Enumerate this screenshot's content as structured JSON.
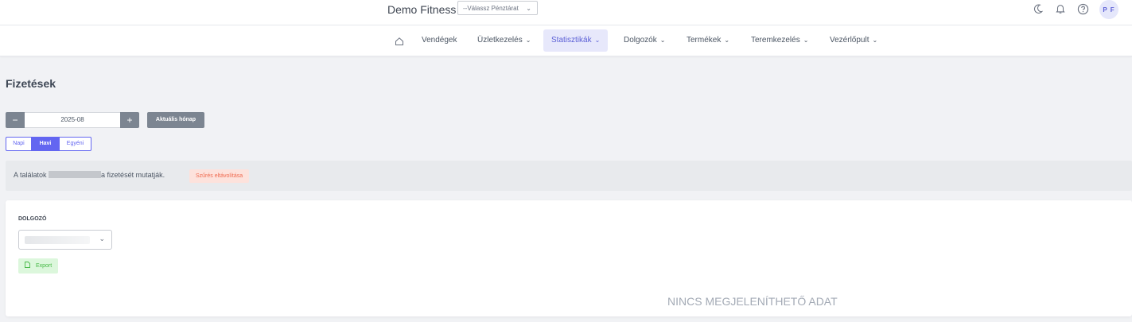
{
  "header": {
    "brand": "Demo Fitness",
    "register_select": {
      "value": "--Válassz Pénztárat"
    },
    "avatar_initials": "P F"
  },
  "nav": {
    "items": [
      {
        "label": "Vendégek",
        "has_menu": false
      },
      {
        "label": "Üzletkezelés",
        "has_menu": true
      },
      {
        "label": "Statisztikák",
        "has_menu": true,
        "active": true
      },
      {
        "label": "Dolgozók",
        "has_menu": true
      },
      {
        "label": "Termékek",
        "has_menu": true
      },
      {
        "label": "Teremkezelés",
        "has_menu": true
      },
      {
        "label": "Vezérlőpult",
        "has_menu": true
      }
    ]
  },
  "page": {
    "title": "Fizetések",
    "month": {
      "minus": "−",
      "value": "2025-08",
      "plus": "+"
    },
    "current_month_label": "Aktuális hónap",
    "view_modes": [
      {
        "label": "Napi",
        "active": false
      },
      {
        "label": "Havi",
        "active": true
      },
      {
        "label": "Egyéni",
        "active": false
      }
    ],
    "filter": {
      "prefix": "A találatok",
      "suffix": "a fizetését mutatják.",
      "remove_label": "Szűrés eltávolítása"
    },
    "card": {
      "employee_label": "DOLGOZÓ",
      "export_label": "Export",
      "empty_text": "NINCS MEGJELENÍTHETŐ ADAT"
    }
  },
  "colors": {
    "accent": "#6366f1",
    "active_nav_bg": "#e7e8fb",
    "export_bg": "#dcf7dc",
    "remove_filter_bg": "#fde2dc"
  },
  "icons": [
    "moon-icon",
    "bell-icon",
    "help-icon",
    "home-icon",
    "chevron-down-icon",
    "file-icon"
  ]
}
